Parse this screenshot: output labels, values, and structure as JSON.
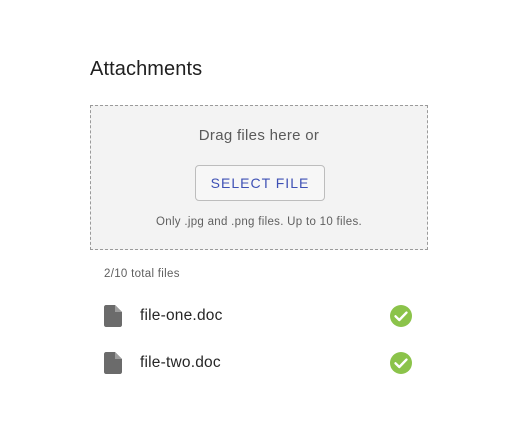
{
  "attachments": {
    "title": "Attachments",
    "dropzone": {
      "drag_text": "Drag files here or",
      "select_button_label": "SELECT FILE",
      "hint": "Only .jpg and .png files. Up to 10 files."
    },
    "file_count_text": "2/10 total files",
    "files": [
      {
        "name": "file-one.doc",
        "icon": "file-icon",
        "status_icon": "check-circle-icon"
      },
      {
        "name": "file-two.doc",
        "icon": "file-icon",
        "status_icon": "check-circle-icon"
      }
    ]
  },
  "colors": {
    "accent": "#3f51b5",
    "success": "#8bc34a",
    "file_icon": "#6b6b6b",
    "dropzone_bg": "#f3f3f3"
  }
}
